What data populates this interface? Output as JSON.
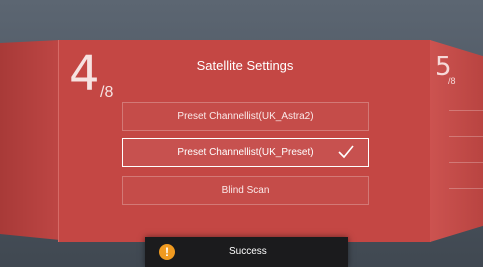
{
  "wizard": {
    "current_step": "4",
    "total_steps": "/8",
    "title": "Satellite Settings",
    "options": [
      {
        "label": "Preset Channellist(UK_Astra2)",
        "selected": false
      },
      {
        "label": "Preset Channellist(UK_Preset)",
        "selected": true
      },
      {
        "label": "Blind Scan",
        "selected": false
      }
    ]
  },
  "next_panel": {
    "step": "5",
    "total": "/8"
  },
  "toast": {
    "icon": "warning-icon",
    "icon_color": "#f09a20",
    "message": "Success"
  },
  "colors": {
    "panel": "#c44744",
    "background": "#4c5663"
  }
}
